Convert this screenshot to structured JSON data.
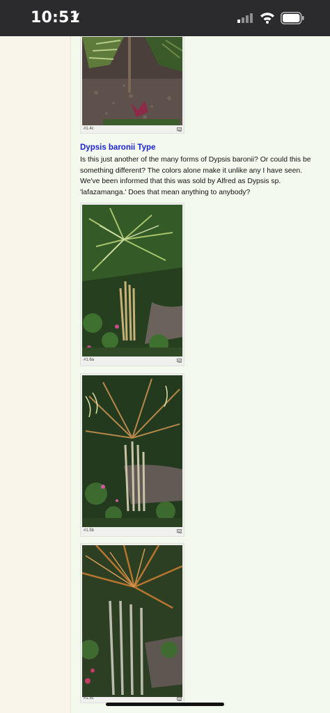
{
  "status_bar": {
    "time": "10:51",
    "icons": [
      "location-arrow-icon",
      "cellular-signal-icon",
      "wifi-icon",
      "battery-icon"
    ]
  },
  "article": {
    "section_title": "Dypsis baronii Type",
    "body": "Is this just another of the many forms of Dypsis baronii? Or could this be something different? The colors alone make it unlike any I have seen. We've been informed that this was sold by Alfred as Dypsis sp. 'lafazamanga.' Does that mean anything to anybody?",
    "photos": [
      {
        "caption": "#1.4c"
      },
      {
        "caption": "#1.6a"
      },
      {
        "caption": "#1.5b"
      },
      {
        "caption": "#1.5c"
      }
    ]
  },
  "colors": {
    "title_link": "#1a24d6",
    "content_bg": "#f4f9ee",
    "margin_bg": "#faf5ea",
    "status_bar_bg": "#2b2b2d"
  }
}
